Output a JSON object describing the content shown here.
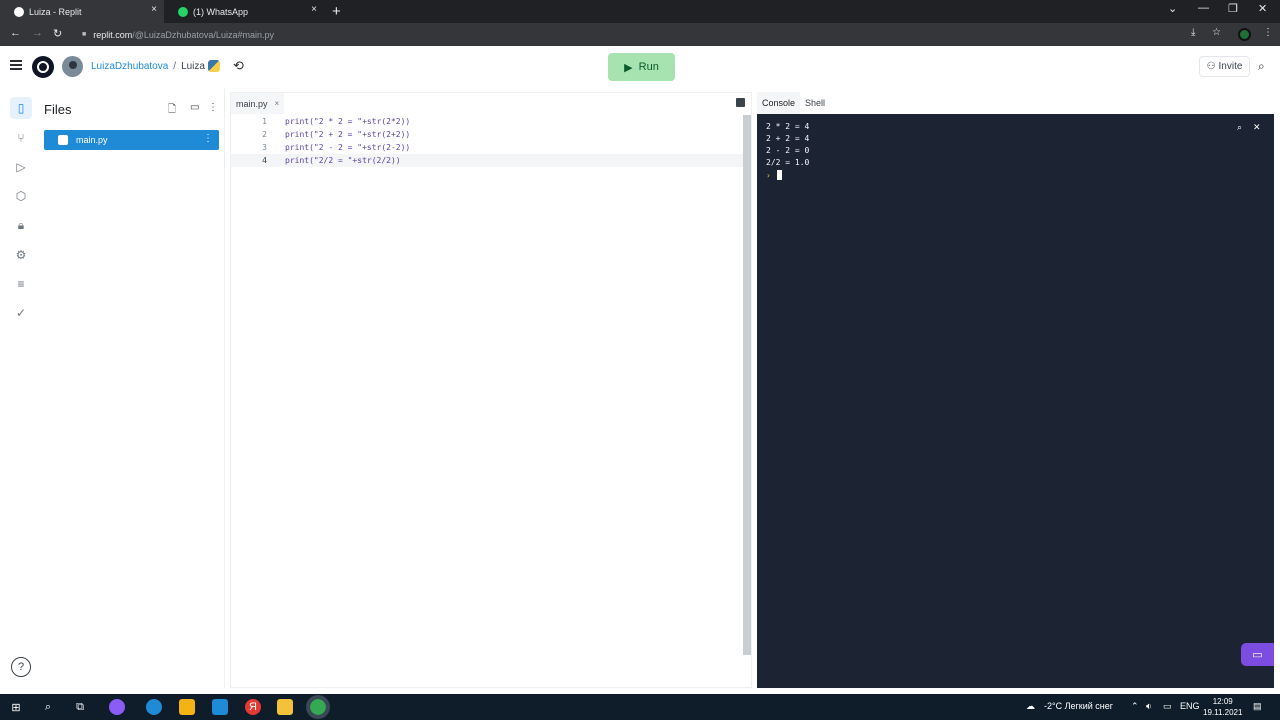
{
  "browser": {
    "tabs": [
      {
        "title": "Luiza - Replit",
        "active": true
      },
      {
        "title": "(1) WhatsApp",
        "active": false
      }
    ],
    "new_tab_glyph": "+",
    "close_glyph": "×",
    "url_host": "replit.com",
    "url_rest": "/@LuizaDzhubatova/Luiza#main.py"
  },
  "header": {
    "username": "LuizaDzhubatova",
    "separator": "/",
    "repl_name": "Luiza",
    "run_label": "Run",
    "invite_label": "Invite"
  },
  "files": {
    "title": "Files",
    "items": [
      {
        "name": "main.py",
        "selected": true
      }
    ]
  },
  "editor": {
    "tab_label": "main.py",
    "lines": [
      {
        "num": "1",
        "code": "print(\"2 * 2 = \"+str(2*2))"
      },
      {
        "num": "2",
        "code": "print(\"2 + 2 = \"+str(2+2))"
      },
      {
        "num": "3",
        "code": "print(\"2 - 2 = \"+str(2-2))"
      },
      {
        "num": "4",
        "code": "print(\"2/2 = \"+str(2/2))"
      }
    ]
  },
  "console": {
    "tabs": [
      "Console",
      "Shell"
    ],
    "active_tab": "Console",
    "output": [
      "2 * 2 = 4",
      "2 + 2 = 4",
      "2 - 2 = 0",
      "2/2 = 1.0"
    ],
    "prompt": "›"
  },
  "taskbar": {
    "weather": "-2°C  Легкий снег",
    "language": "ENG",
    "time": "12:09",
    "date": "19.11.2021"
  },
  "colors": {
    "accent": "#1f8ad6",
    "run_button": "#a6e3b0",
    "console_bg": "#1c2333",
    "taskbar_bg": "#0f1d2b"
  }
}
